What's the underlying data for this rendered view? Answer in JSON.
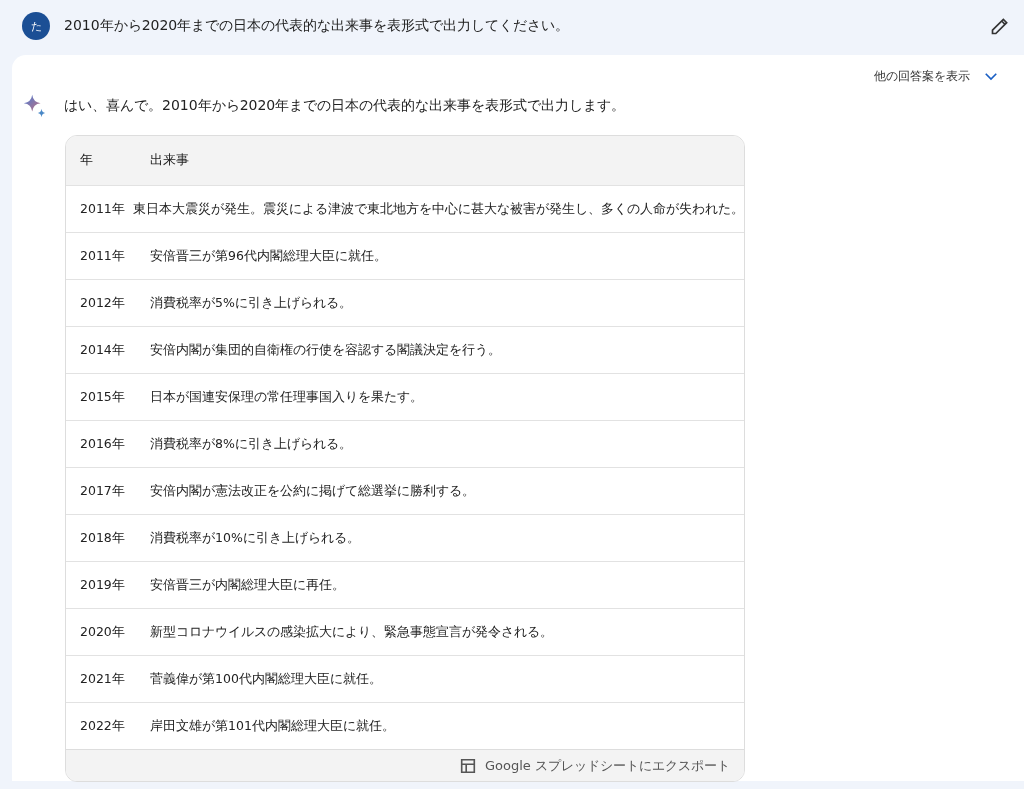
{
  "prompt": {
    "avatar": "た",
    "text": "2010年から2020年までの日本の代表的な出来事を表形式で出力してください。"
  },
  "response": {
    "drafts_label": "他の回答案を表示",
    "intro": "はい、喜んで。2010年から2020年までの日本の代表的な出来事を表形式で出力します。",
    "table": {
      "columns": [
        "年",
        "出来事"
      ],
      "rows": [
        [
          "2011年",
          "東日本大震災が発生。震災による津波で東北地方を中心に甚大な被害が発生し、多くの人命が失われた。"
        ],
        [
          "2011年",
          "安倍晋三が第96代内閣総理大臣に就任。"
        ],
        [
          "2012年",
          "消費税率が5%に引き上げられる。"
        ],
        [
          "2014年",
          "安倍内閣が集団的自衛権の行使を容認する閣議決定を行う。"
        ],
        [
          "2015年",
          "日本が国連安保理の常任理事国入りを果たす。"
        ],
        [
          "2016年",
          "消費税率が8%に引き上げられる。"
        ],
        [
          "2017年",
          "安倍内閣が憲法改正を公約に掲げて総選挙に勝利する。"
        ],
        [
          "2018年",
          "消費税率が10%に引き上げられる。"
        ],
        [
          "2019年",
          "安倍晋三が内閣総理大臣に再任。"
        ],
        [
          "2020年",
          "新型コロナウイルスの感染拡大により、緊急事態宣言が発令される。"
        ],
        [
          "2021年",
          "菅義偉が第100代内閣総理大臣に就任。"
        ],
        [
          "2022年",
          "岸田文雄が第101代内閣総理大臣に就任。"
        ]
      ]
    },
    "export_label": "Google スプレッドシートにエクスポート"
  }
}
